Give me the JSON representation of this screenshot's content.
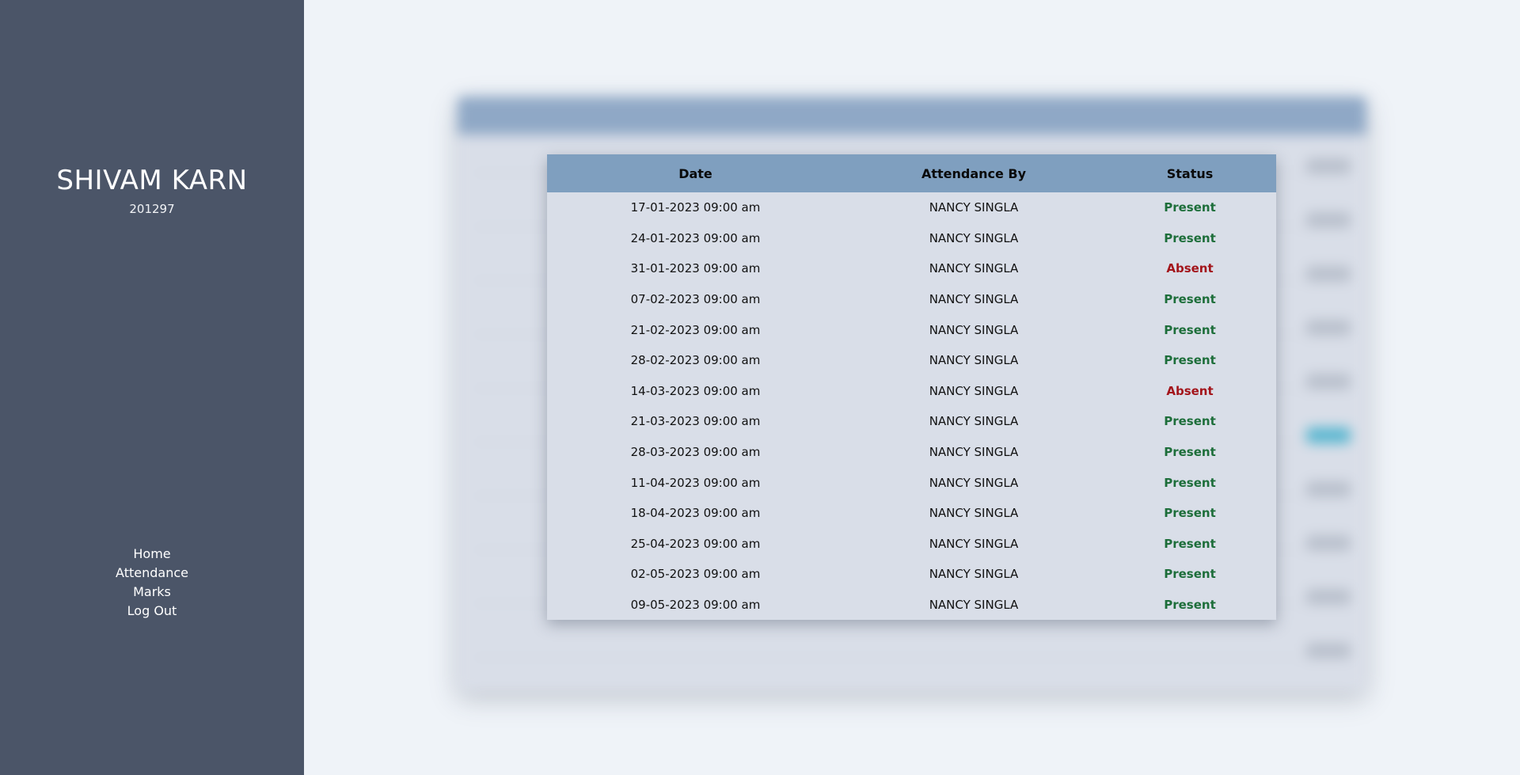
{
  "student": {
    "name": "SHIVAM KARN",
    "id": "201297"
  },
  "nav": {
    "items": [
      "Home",
      "Attendance",
      "Marks",
      "Log Out"
    ]
  },
  "table": {
    "headers": {
      "date": "Date",
      "attendance_by": "Attendance By",
      "status": "Status"
    },
    "rows": [
      {
        "date": "17-01-2023 09:00 am",
        "by": "NANCY SINGLA",
        "status": "Present"
      },
      {
        "date": "24-01-2023 09:00 am",
        "by": "NANCY SINGLA",
        "status": "Present"
      },
      {
        "date": "31-01-2023 09:00 am",
        "by": "NANCY SINGLA",
        "status": "Absent"
      },
      {
        "date": "07-02-2023 09:00 am",
        "by": "NANCY SINGLA",
        "status": "Present"
      },
      {
        "date": "21-02-2023 09:00 am",
        "by": "NANCY SINGLA",
        "status": "Present"
      },
      {
        "date": "28-02-2023 09:00 am",
        "by": "NANCY SINGLA",
        "status": "Present"
      },
      {
        "date": "14-03-2023 09:00 am",
        "by": "NANCY SINGLA",
        "status": "Absent"
      },
      {
        "date": "21-03-2023 09:00 am",
        "by": "NANCY SINGLA",
        "status": "Present"
      },
      {
        "date": "28-03-2023 09:00 am",
        "by": "NANCY SINGLA",
        "status": "Present"
      },
      {
        "date": "11-04-2023 09:00 am",
        "by": "NANCY SINGLA",
        "status": "Present"
      },
      {
        "date": "18-04-2023 09:00 am",
        "by": "NANCY SINGLA",
        "status": "Present"
      },
      {
        "date": "25-04-2023 09:00 am",
        "by": "NANCY SINGLA",
        "status": "Present"
      },
      {
        "date": "02-05-2023 09:00 am",
        "by": "NANCY SINGLA",
        "status": "Present"
      },
      {
        "date": "09-05-2023 09:00 am",
        "by": "NANCY SINGLA",
        "status": "Present"
      }
    ]
  },
  "colors": {
    "sidebar": "#4b5568",
    "table_header": "#7f9fbf",
    "present": "#1d6e3a",
    "absent": "#a3151b"
  }
}
